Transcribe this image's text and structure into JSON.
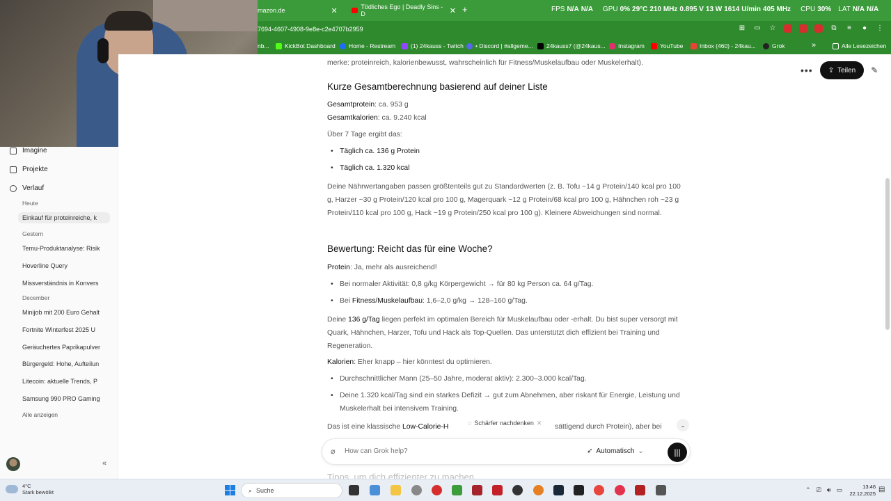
{
  "browser": {
    "tabs": [
      {
        "title": "mazon.de"
      },
      {
        "title": "Tödliches Ego | Deadly Sins - D"
      }
    ],
    "new_tab": "+",
    "url": "7694-4607-4908-9e8e-c2e4707b2959",
    "overlay": {
      "fps_label": "FPS",
      "fps_1": "N/A",
      "fps_2": "N/A",
      "gpu_label": "GPU",
      "gpu": "0%",
      "gpu_temp": "29°C",
      "gpu_clock": "210 MHz",
      "gpu_volt": "0.895 V",
      "gpu_power": "13 W",
      "gpu_fan": "1614 U/min",
      "gpu_mem": "405 MHz",
      "cpu_label": "CPU",
      "cpu": "30%",
      "lat_label": "LAT",
      "lat": "N/A",
      "lat2": "N/A"
    },
    "bookmarks": [
      {
        "label": "nb...",
        "color": "#ffffff"
      },
      {
        "label": "KickBot Dashboard",
        "color": "#53fc18"
      },
      {
        "label": "Home - Restream",
        "color": "#1e6bff"
      },
      {
        "label": "(1) 24kauss - Twitch",
        "color": "#9146ff"
      },
      {
        "label": "• Discord | #allgeme...",
        "color": "#5865f2"
      },
      {
        "label": "24kauss7 (@24kaus...",
        "color": "#000000"
      },
      {
        "label": "Instagram",
        "color": "#e1306c"
      },
      {
        "label": "YouTube",
        "color": "#ff0000"
      },
      {
        "label": "Inbox (460) - 24kau...",
        "color": "#ea4335"
      },
      {
        "label": "Grok",
        "color": "#222222"
      }
    ],
    "bookmarks_more": "»",
    "all_bookmarks": "Alle Lesezeichen"
  },
  "sidebar": {
    "nav": [
      {
        "label": "Imagine"
      },
      {
        "label": "Projekte"
      },
      {
        "label": "Verlauf"
      }
    ],
    "groups": [
      {
        "title": "Heute",
        "items": [
          "Einkauf für proteinreiche, k"
        ]
      },
      {
        "title": "Gestern",
        "items": [
          "Temu-Produktanalyse: Risik",
          "Hoverline Query",
          "Missverständnis in Konvers"
        ]
      },
      {
        "title": "December",
        "items": [
          "Minijob mit 200 Euro Gehalt",
          "Fortnite Winterfest 2025 U",
          "Geräuchertes Paprikapulver",
          "Bürgergeld: Hohe, Aufteilun",
          "Litecoin: aktuelle Trends, P",
          "Samsung 990 PRO Gaming"
        ]
      }
    ],
    "show_all": "Alle anzeigen",
    "collapse": "«"
  },
  "header": {
    "share_label": "Teilen"
  },
  "chat": {
    "intro_tail": "merke: proteinreich, kalorienbewusst, wahrscheinlich für Fitness/Muskelaufbau oder Muskelerhalt).",
    "section1_title": "Kurze Gesamtberechnung basierend auf deiner Liste",
    "protein_label": "Gesamtprotein",
    "protein_value": ": ca. 953 g",
    "kcal_label": "Gesamtkalorien",
    "kcal_value": ": ca. 9.240 kcal",
    "over7": "Über 7 Tage ergibt das:",
    "daily_protein": "Täglich ca. 136 g Protein",
    "daily_kcal": "Täglich ca. 1.320 kcal",
    "nutrition_note": "Deine Nährwertangaben passen größtenteils gut zu Standardwerten (z. B. Tofu ~14 g Protein/140 kcal pro 100 g, Harzer ~30 g Protein/120 kcal pro 100 g, Magerquark ~12 g Protein/68 kcal pro 100 g, Hähnchen roh ~23 g Protein/110 kcal pro 100 g, Hack ~19 g Protein/250 kcal pro 100 g). Kleinere Abweichungen sind normal.",
    "section2_title": "Bewertung: Reicht das für eine Woche?",
    "protein_eval_label": "Protein",
    "protein_eval": ": Ja, mehr als ausreichend!",
    "normal_activity": "Bei normaler Aktivität: 0,8 g/kg Körpergewicht → für 80 kg Person ca. 64 g/Tag.",
    "fitness_prefix": "Bei ",
    "fitness_label": "Fitness/Muskelaufbau",
    "fitness_value": ": 1,6–2,0 g/kg → 128–160 g/Tag.",
    "para_prefix": "Deine ",
    "para_strong": "136 g/Tag",
    "para_rest": " liegen perfekt im optimalen Bereich für Muskelaufbau oder -erhalt. Du bist super versorgt mit Quark, Hähnchen, Harzer, Tofu und Hack als Top-Quellen. Das unterstützt dich effizient bei Training und Regeneration.",
    "kcal_eval_label": "Kalorien",
    "kcal_eval": ": Eher knapp – hier könntest du optimieren.",
    "avg_man": "Durchschnittlicher Mann (25–50 Jahre, moderat aktiv): 2.300–3.000 kcal/Tag.",
    "deficit": "Deine 1.320 kcal/Tag sind ein starkes Defizit → gut zum Abnehmen, aber riskant für Energie, Leistung und Muskelerhalt bei intensivem Training.",
    "classic_prefix": "Das ist eine klassische ",
    "classic_strong": "Low-Calorie-H",
    "classic_rest": "sättigend durch Protein), aber bei",
    "tips_title": "Tipps, um dich effizienter zu machen"
  },
  "composer": {
    "think_pill": "Schärfer nachdenken",
    "placeholder": "How can Grok help?",
    "mode": "Automatisch"
  },
  "taskbar": {
    "weather_temp": "4°C",
    "weather_text": "Stark bewölkt",
    "search": "Suche",
    "time": "13:46",
    "date": "22.12.2025"
  }
}
